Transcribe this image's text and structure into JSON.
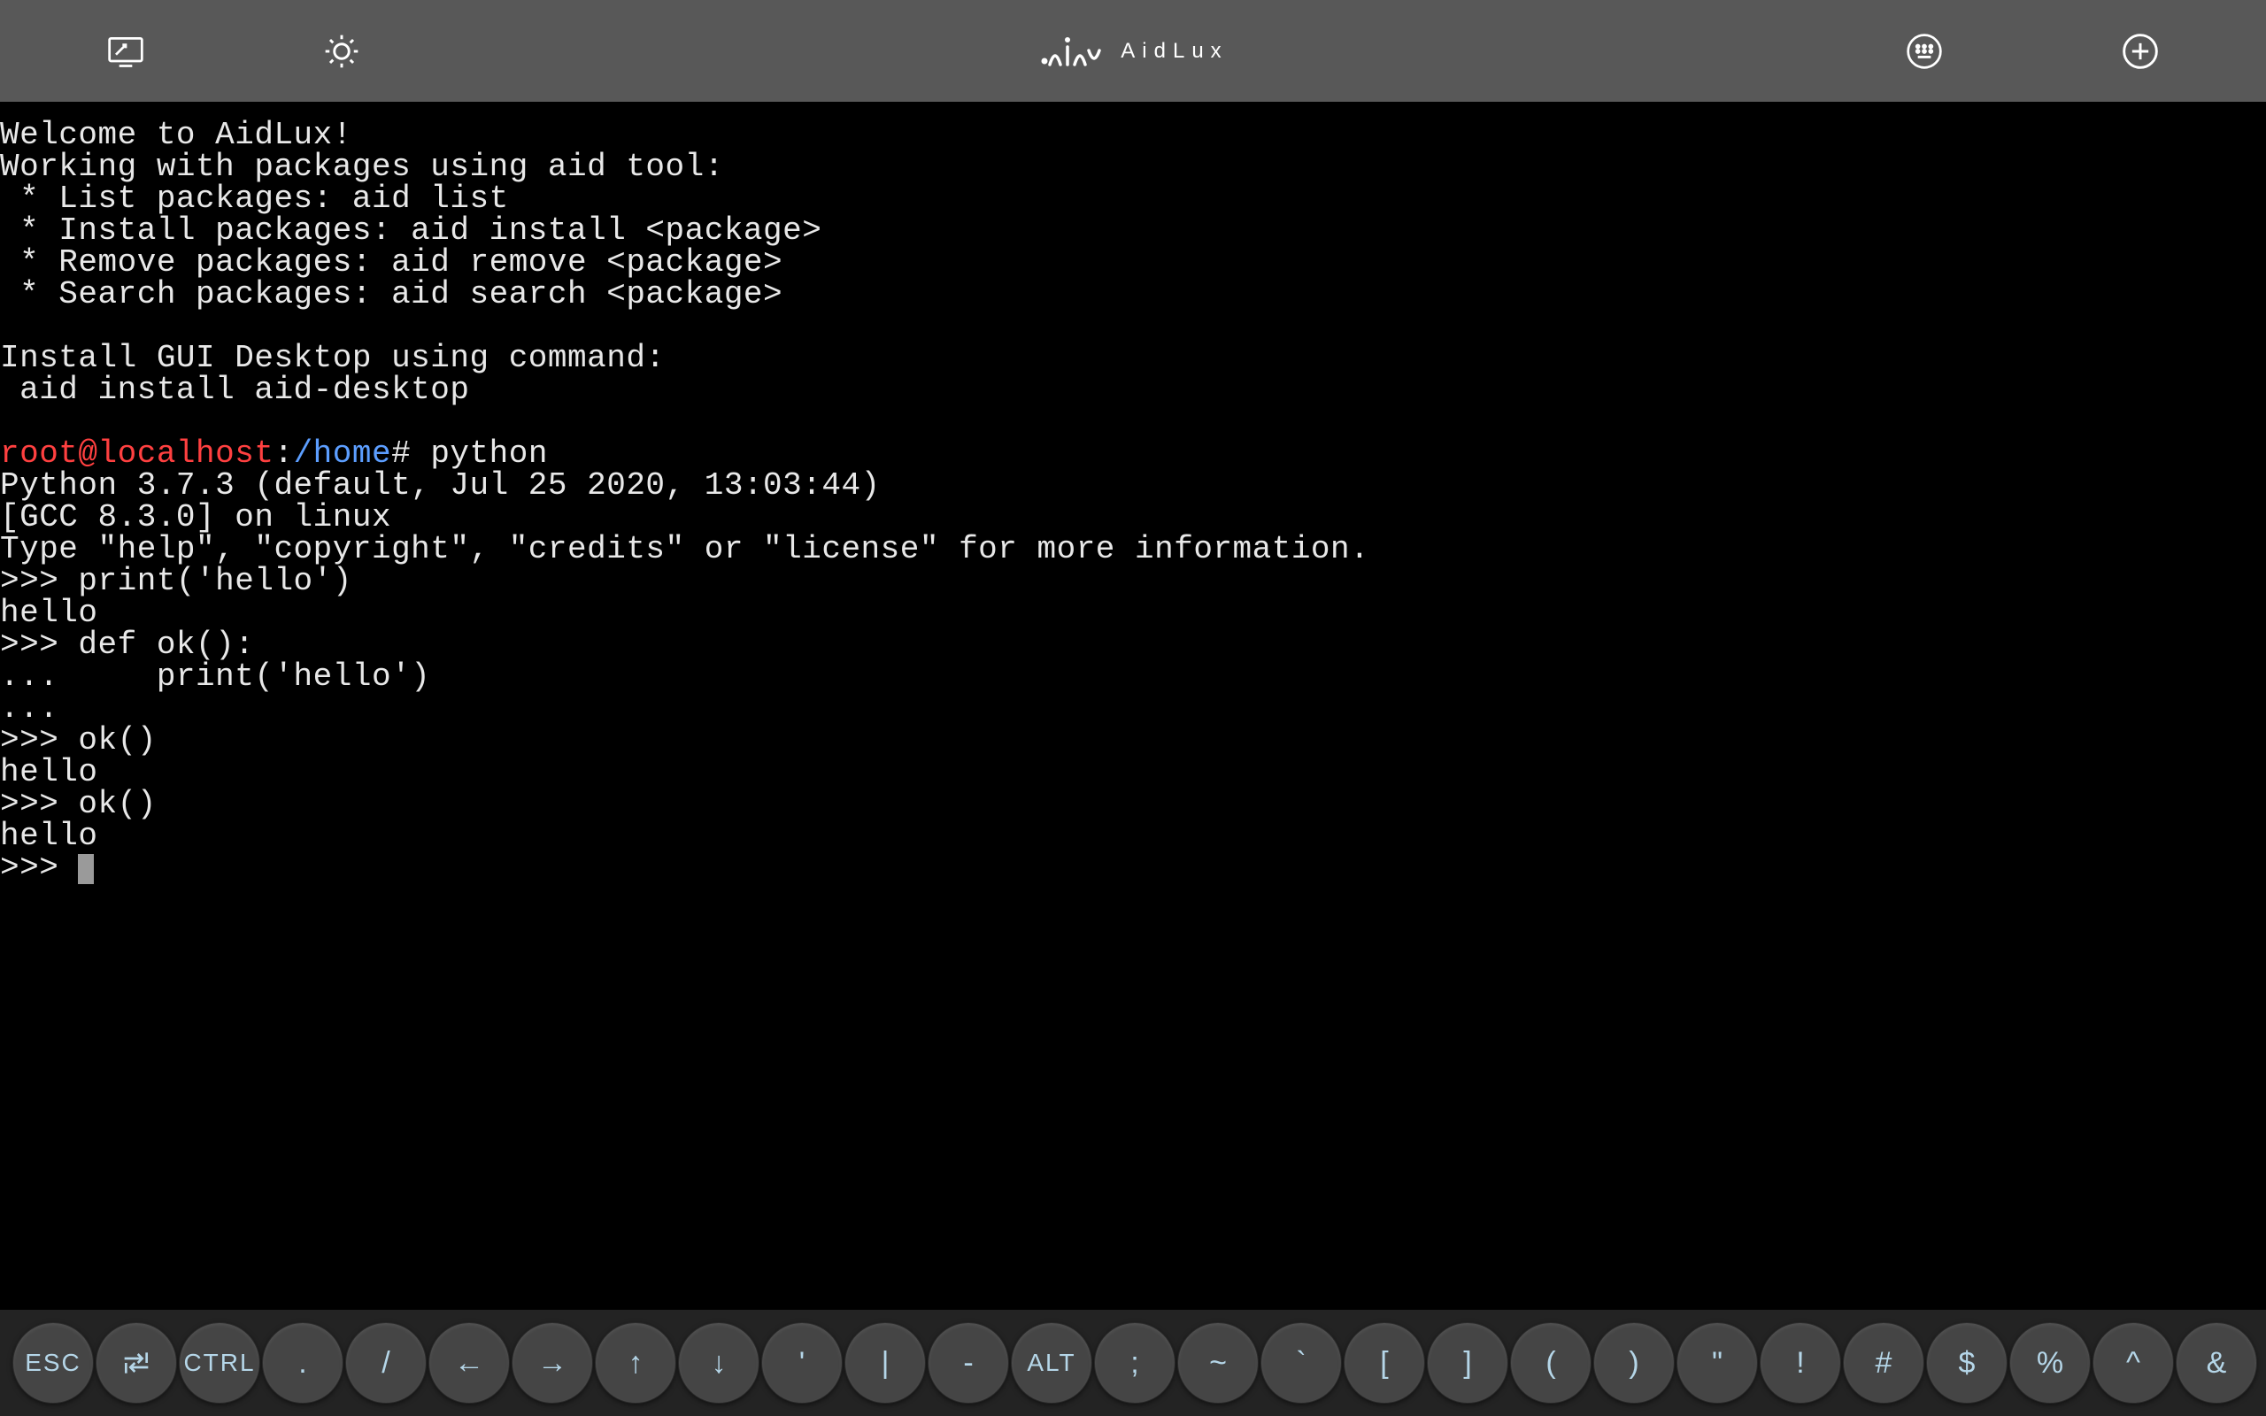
{
  "header": {
    "brand": "AidLux"
  },
  "terminal": {
    "welcome": "Welcome to AidLux!",
    "working": "Working with packages using aid tool:",
    "list": " * List packages: aid list",
    "install": " * Install packages: aid install <package>",
    "remove": " * Remove packages: aid remove <package>",
    "search": " * Search packages: aid search <package>",
    "gui1": "Install GUI Desktop using command:",
    "gui2": " aid install aid-desktop",
    "prompt_user": "root@localhost",
    "prompt_colon": ":",
    "prompt_path": "/home",
    "prompt_hash": "# ",
    "cmd_python": "python",
    "py_line1": "Python 3.7.3 (default, Jul 25 2020, 13:03:44)",
    "py_line2": "[GCC 8.3.0] on linux",
    "py_line3": "Type \"help\", \"copyright\", \"credits\" or \"license\" for more information.",
    "repl1": ">>> print('hello')",
    "out1": "hello",
    "repl2": ">>> def ok():",
    "repl3": "...     print('hello')",
    "repl4": "...",
    "repl5": ">>> ok()",
    "out2": "hello",
    "repl6": ">>> ok()",
    "out3": "hello",
    "repl7": ">>> "
  },
  "keys": {
    "esc": "ESC",
    "ctrl": "CTRL",
    "dot": ".",
    "slash": "/",
    "left": "←",
    "right": "→",
    "up": "↑",
    "down": "↓",
    "squote": "'",
    "pipe": "|",
    "dash": "-",
    "alt": "ALT",
    "semi": ";",
    "tilde": "~",
    "backtick": "`",
    "lbracket": "[",
    "rbracket": "]",
    "lparen": "(",
    "rparen": ")",
    "dquote": "\"",
    "bang": "!",
    "hash": "#",
    "dollar": "$",
    "percent": "%",
    "caret": "^",
    "amp": "&"
  }
}
